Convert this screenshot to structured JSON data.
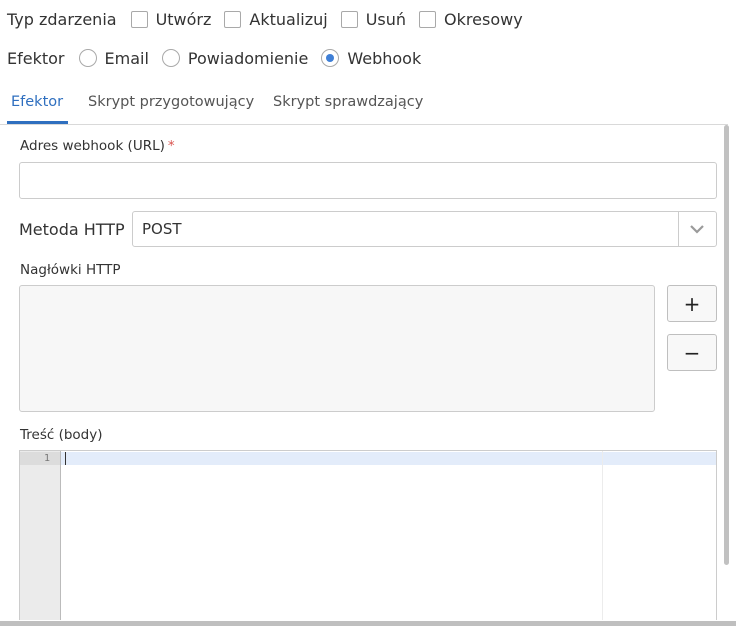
{
  "event_type": {
    "label": "Typ zdarzenia",
    "options": [
      {
        "label": "Utwórz",
        "checked": false
      },
      {
        "label": "Aktualizuj",
        "checked": false
      },
      {
        "label": "Usuń",
        "checked": false
      },
      {
        "label": "Okresowy",
        "checked": false
      }
    ]
  },
  "effector": {
    "label": "Efektor",
    "options": [
      {
        "label": "Email",
        "selected": false
      },
      {
        "label": "Powiadomienie",
        "selected": false
      },
      {
        "label": "Webhook",
        "selected": true
      }
    ]
  },
  "tabs": [
    {
      "label": "Efektor",
      "active": true
    },
    {
      "label": "Skrypt przygotowujący",
      "active": false
    },
    {
      "label": "Skrypt sprawdzający",
      "active": false
    }
  ],
  "form": {
    "url_label": "Adres webhook (URL)",
    "required_mark": "*",
    "url_value": "",
    "method_label": "Metoda HTTP",
    "method_value": "POST",
    "headers_label": "Nagłówki HTTP",
    "add_symbol": "+",
    "remove_symbol": "−",
    "body_label": "Treść (body)",
    "line_number": "1"
  },
  "colors": {
    "accent": "#2f6fbf",
    "radio_dot": "#3f7fd6",
    "required": "#d9534f"
  }
}
